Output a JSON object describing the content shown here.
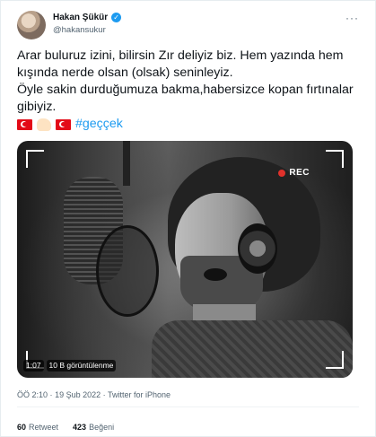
{
  "user": {
    "display_name": "Hakan Şükür",
    "handle": "@hakansukur",
    "verified_icon": "✓",
    "more_icon": "···"
  },
  "tweet": {
    "paragraph_1": "Arar buluruz izini, bilirsin Zır deliyiz biz. Hem yazında hem kışında nerde olsan (olsak) seninleyiz.",
    "paragraph_2": "Öyle sakin durduğumuza bakma,habersizce kopan fırtınalar gibiyiz.",
    "hashtag": "#geççek",
    "emojis": [
      "turkish-flag",
      "flexed-biceps",
      "turkish-flag"
    ]
  },
  "media": {
    "rec_label": "REC",
    "duration": "1:07",
    "views": "10 B görüntülenme"
  },
  "meta": {
    "time": "ÖÖ 2:10",
    "separator": "·",
    "date": "19 Şub 2022",
    "client": "Twitter for iPhone"
  },
  "stats": {
    "retweets": "60",
    "retweets_label": "Retweet",
    "likes": "423",
    "likes_label": "Beğeni"
  }
}
